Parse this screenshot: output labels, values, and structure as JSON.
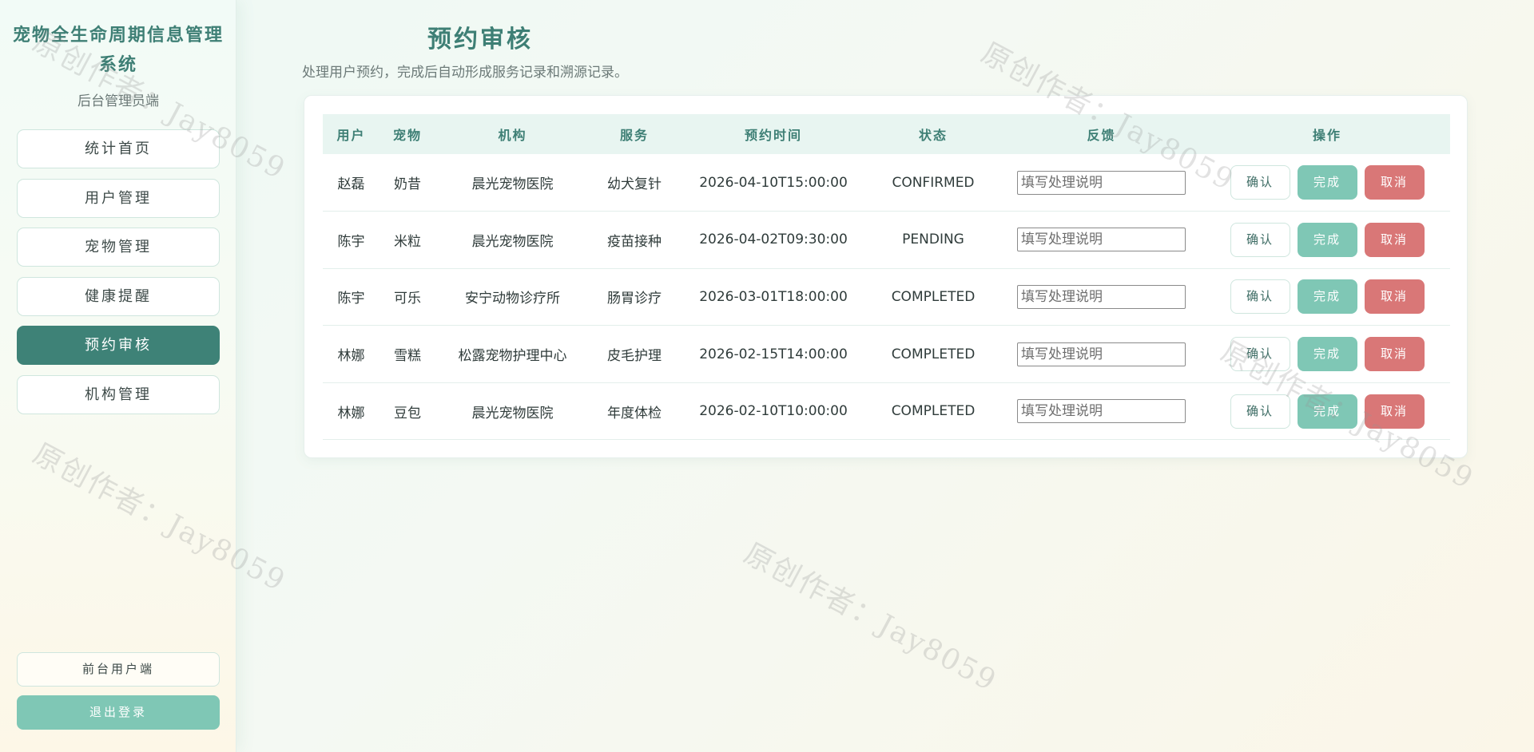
{
  "sidebar": {
    "title": "宠物全生命周期信息管理系统",
    "subtitle": "后台管理员端",
    "items": [
      {
        "label": "统计首页",
        "active": false
      },
      {
        "label": "用户管理",
        "active": false
      },
      {
        "label": "宠物管理",
        "active": false
      },
      {
        "label": "健康提醒",
        "active": false
      },
      {
        "label": "预约审核",
        "active": true
      },
      {
        "label": "机构管理",
        "active": false
      }
    ],
    "front_label": "前台用户端",
    "logout_label": "退出登录"
  },
  "main": {
    "title": "预约审核",
    "description": "处理用户预约，完成后自动形成服务记录和溯源记录。"
  },
  "table": {
    "headers": [
      "用户",
      "宠物",
      "机构",
      "服务",
      "预约时间",
      "状态",
      "反馈",
      "操作"
    ],
    "rows": [
      {
        "user": "赵磊",
        "pet": "奶昔",
        "org": "晨光宠物医院",
        "service": "幼犬复针",
        "time": "2026-04-10T15:00:00",
        "status": "CONFIRMED"
      },
      {
        "user": "陈宇",
        "pet": "米粒",
        "org": "晨光宠物医院",
        "service": "疫苗接种",
        "time": "2026-04-02T09:30:00",
        "status": "PENDING"
      },
      {
        "user": "陈宇",
        "pet": "可乐",
        "org": "安宁动物诊疗所",
        "service": "肠胃诊疗",
        "time": "2026-03-01T18:00:00",
        "status": "COMPLETED"
      },
      {
        "user": "林娜",
        "pet": "雪糕",
        "org": "松露宠物护理中心",
        "service": "皮毛护理",
        "time": "2026-02-15T14:00:00",
        "status": "COMPLETED"
      },
      {
        "user": "林娜",
        "pet": "豆包",
        "org": "晨光宠物医院",
        "service": "年度体检",
        "time": "2026-02-10T10:00:00",
        "status": "COMPLETED"
      }
    ],
    "feedback_placeholder": "填写处理说明",
    "confirm_label": "确认",
    "done_label": "完成",
    "cancel_label": "取消"
  },
  "watermark": "原创作者：Jay8059",
  "colors": {
    "accent": "#3e8277",
    "accent_light": "#7fc7b5",
    "danger": "#d97777",
    "title": "#3e7f75"
  }
}
